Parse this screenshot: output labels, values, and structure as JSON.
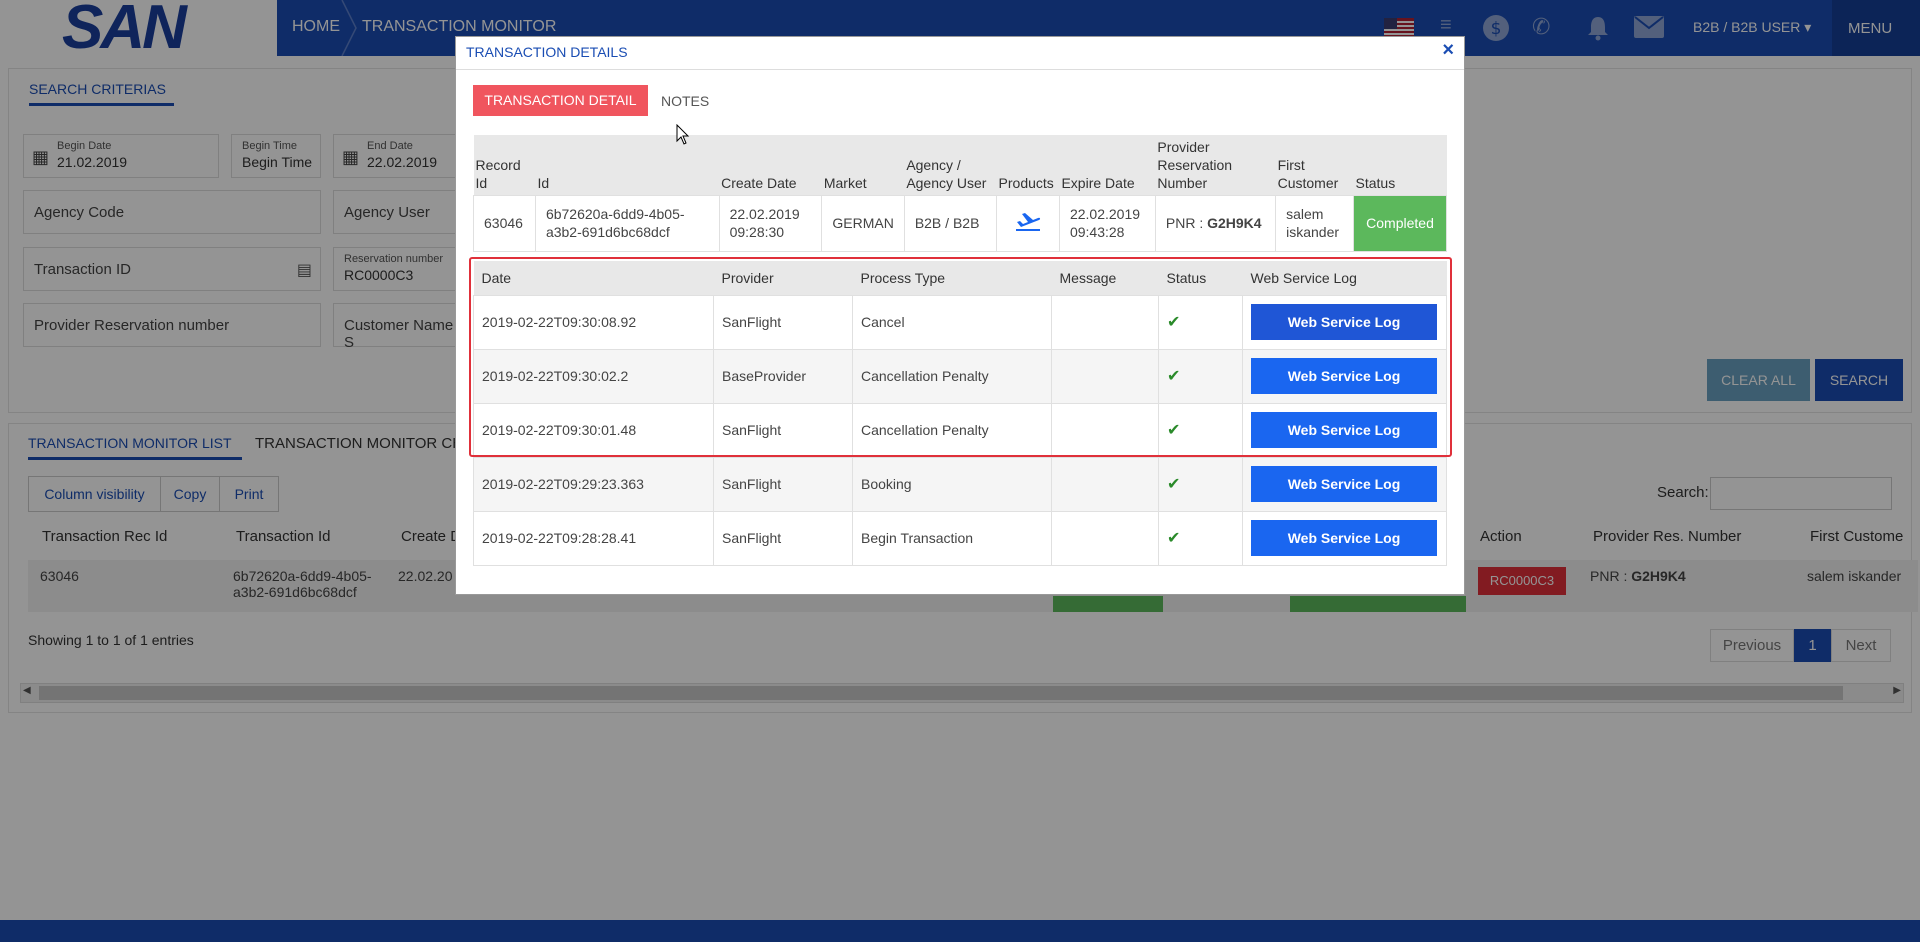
{
  "header": {
    "logo": "SAN",
    "breadcrumb": [
      "HOME",
      "TRANSACTION MONITOR"
    ],
    "user": "B2B / B2B USER",
    "menu": "MENU"
  },
  "search": {
    "tab": "SEARCH CRITERIAS",
    "begin_date_label": "Begin Date",
    "begin_date": "21.02.2019",
    "begin_time_label": "Begin Time",
    "begin_time": "Begin Time",
    "end_date_label": "End Date",
    "end_date": "22.02.2019",
    "agency_code": "Agency Code",
    "agency_user": "Agency User",
    "transaction_id": "Transaction ID",
    "reservation_label": "Reservation number",
    "reservation_value": "RC0000C3",
    "provider_reservation": "Provider Reservation number",
    "customer_name": "Customer Name S",
    "clear_all": "CLEAR ALL",
    "search": "SEARCH"
  },
  "list": {
    "tab_active": "TRANSACTION MONITOR LIST",
    "tab2": "TRANSACTION MONITOR CHA",
    "buttons": [
      "Column visibility",
      "Copy",
      "Print"
    ],
    "search_label": "Search:",
    "headers": [
      "Transaction Rec Id",
      "Transaction Id",
      "Create D",
      "Action",
      "Provider Res. Number",
      "First Custome"
    ],
    "row": {
      "rec_id": "63046",
      "id": "6b72620a-6dd9-4b05-a3b2-691d6bc68dcf",
      "create": "22.02.20",
      "action": "RC0000C3",
      "pnr_prefix": "PNR :",
      "pnr": "G2H9K4",
      "customer": "salem iskander"
    },
    "showing": "Showing 1 to 1 of 1 entries",
    "pager": [
      "Previous",
      "1",
      "Next"
    ]
  },
  "modal": {
    "title": "TRANSACTION DETAILS",
    "close": "×",
    "tab_active": "TRANSACTION DETAIL",
    "tab": "NOTES",
    "detail_headers": [
      "Record Id",
      "Id",
      "Create Date",
      "Market",
      "Agency / Agency User",
      "Products",
      "Expire Date",
      "Provider Reservation Number",
      "First Customer",
      "Status"
    ],
    "detail": {
      "record_id": "63046",
      "id": "6b72620a-6dd9-4b05-a3b2-691d6bc68dcf",
      "create_date": "22.02.2019 09:28:30",
      "market": "GERMAN",
      "agency": "B2B / B2B",
      "expire_date": "22.02.2019 09:43:28",
      "pnr_prefix": "PNR :",
      "pnr": "G2H9K4",
      "first_customer": "salem iskander",
      "status": "Completed"
    },
    "log_headers": [
      "Date",
      "Provider",
      "Process Type",
      "Message",
      "Status",
      "Web Service Log"
    ],
    "logs": [
      {
        "date": "2019-02-22T09:30:08.92",
        "provider": "SanFlight",
        "process": "Cancel",
        "message": "",
        "button": "Web Service Log"
      },
      {
        "date": "2019-02-22T09:30:02.2",
        "provider": "BaseProvider",
        "process": "Cancellation Penalty",
        "message": "",
        "button": "Web Service Log"
      },
      {
        "date": "2019-02-22T09:30:01.48",
        "provider": "SanFlight",
        "process": "Cancellation Penalty",
        "message": "",
        "button": "Web Service Log"
      },
      {
        "date": "2019-02-22T09:29:23.363",
        "provider": "SanFlight",
        "process": "Booking",
        "message": "",
        "button": "Web Service Log"
      },
      {
        "date": "2019-02-22T09:28:28.41",
        "provider": "SanFlight",
        "process": "Begin Transaction",
        "message": "",
        "button": "Web Service Log"
      }
    ]
  }
}
